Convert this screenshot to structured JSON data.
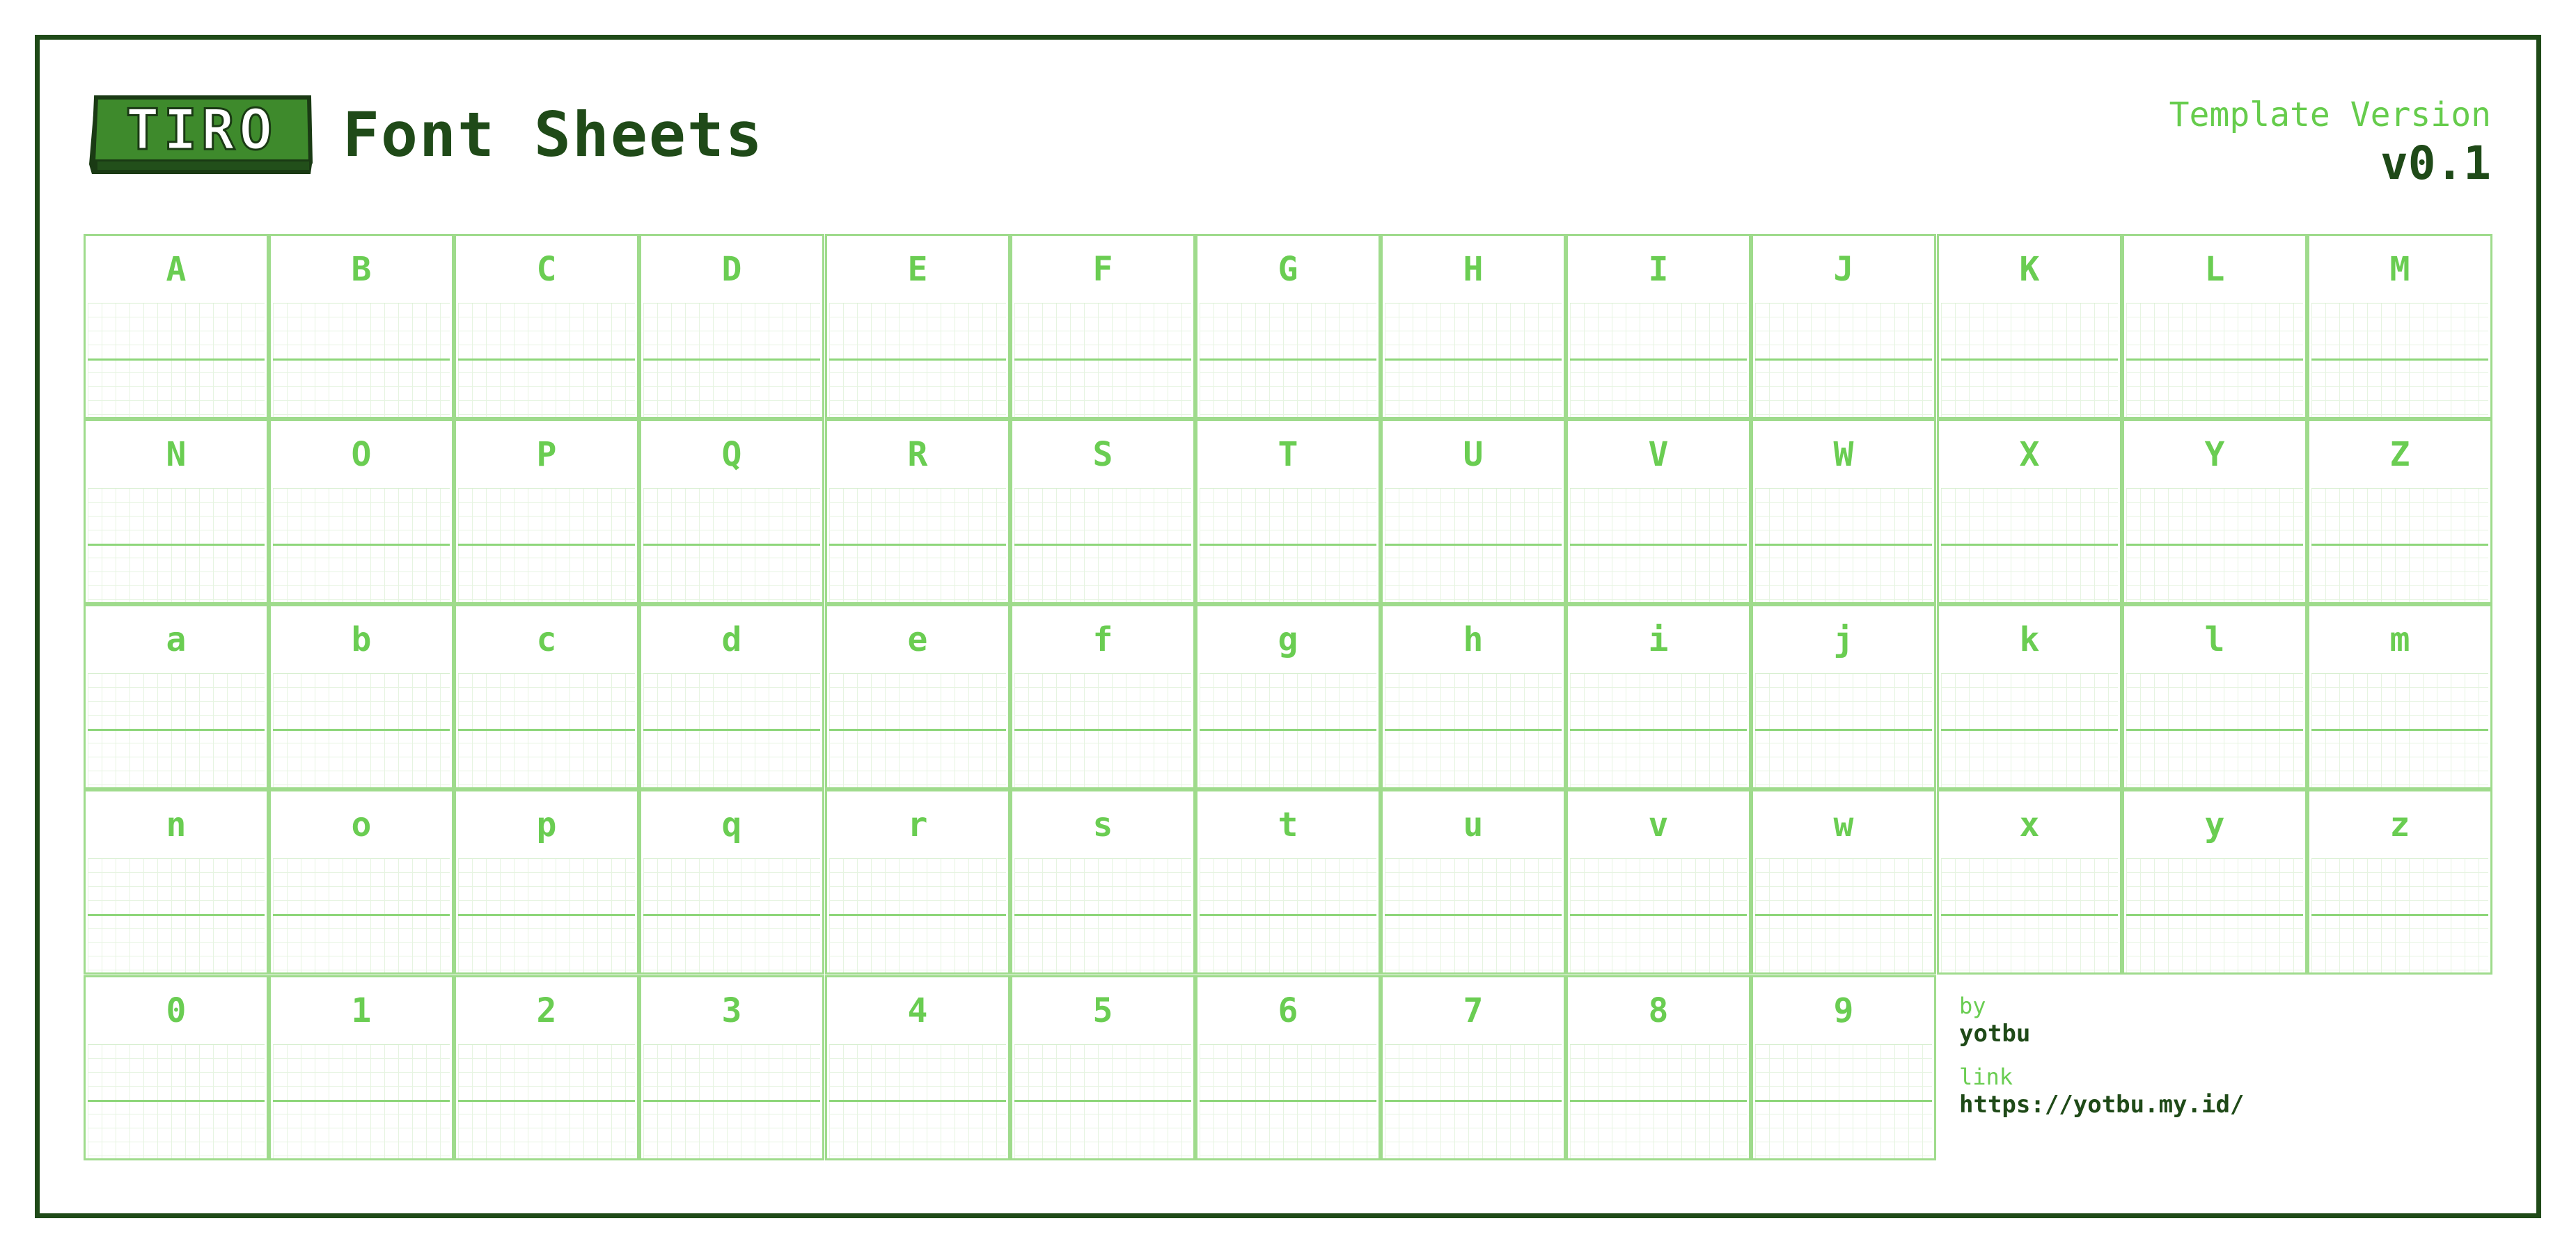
{
  "header": {
    "logo_text": "TIRO",
    "title": "Font Sheets",
    "version_label": "Template Version",
    "version_value": "v0.1"
  },
  "rows": [
    [
      "A",
      "B",
      "C",
      "D",
      "E",
      "F",
      "G",
      "H",
      "I",
      "J",
      "K",
      "L",
      "M"
    ],
    [
      "N",
      "O",
      "P",
      "Q",
      "R",
      "S",
      "T",
      "U",
      "V",
      "W",
      "X",
      "Y",
      "Z"
    ],
    [
      "a",
      "b",
      "c",
      "d",
      "e",
      "f",
      "g",
      "h",
      "i",
      "j",
      "k",
      "l",
      "m"
    ],
    [
      "n",
      "o",
      "p",
      "q",
      "r",
      "s",
      "t",
      "u",
      "v",
      "w",
      "x",
      "y",
      "z"
    ],
    [
      "0",
      "1",
      "2",
      "3",
      "4",
      "5",
      "6",
      "7",
      "8",
      "9"
    ]
  ],
  "credits": {
    "by_label": "by",
    "by_value": "yotbu",
    "link_label": "link",
    "link_value": "https://yotbu.my.id/"
  },
  "colors": {
    "frame": "#1f4a18",
    "accent_light": "#6acd52",
    "cell_border": "#9fdb8c",
    "logo_fill": "#3e8a2c"
  }
}
